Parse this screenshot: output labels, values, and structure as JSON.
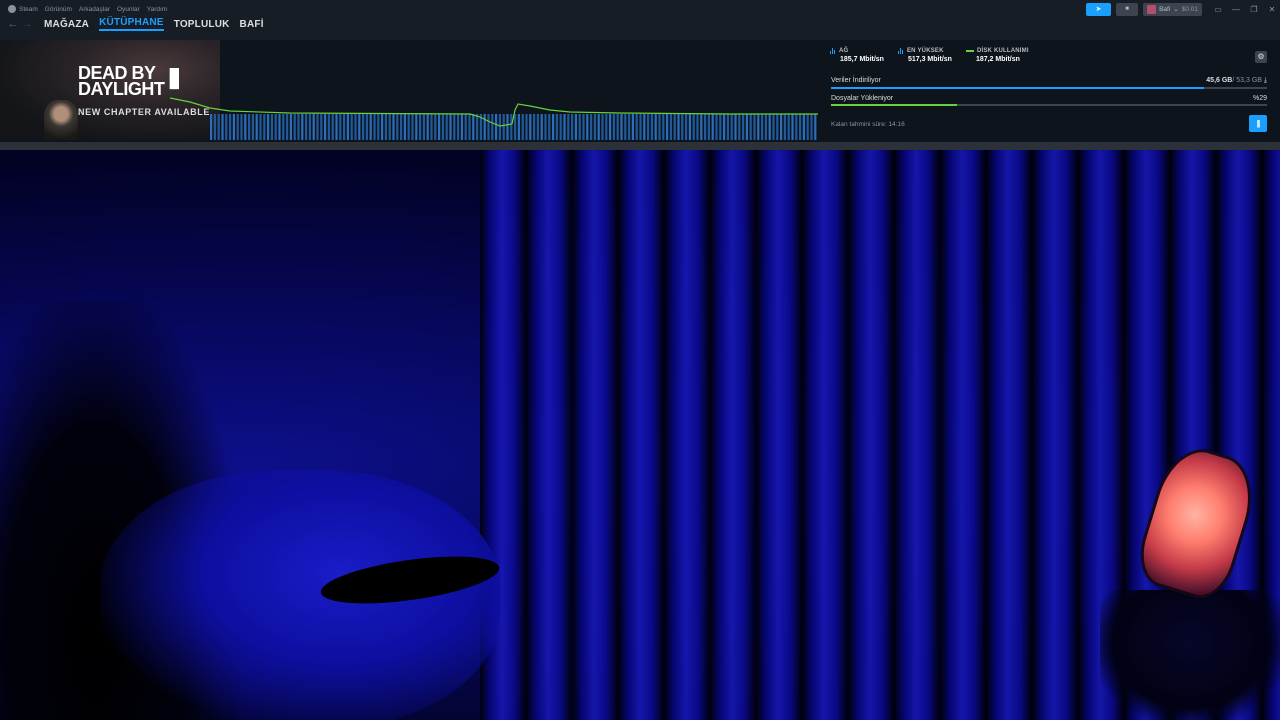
{
  "menu": {
    "app_name": "Steam",
    "items": [
      "Görünüm",
      "Arkadaşlar",
      "Oyunlar",
      "Yardım"
    ]
  },
  "nav": {
    "tabs": [
      "MAĞAZA",
      "KÜTÜPHANE",
      "TOPLULUK",
      "BAFİ"
    ],
    "active_tab": "KÜTÜPHANE"
  },
  "account": {
    "username": "Bafi",
    "balance": "$0.01"
  },
  "banner": {
    "game_title_line1": "DEAD BY",
    "game_title_line2": "DAYLIGHT",
    "subtitle": "NEW CHAPTER AVAILABLE"
  },
  "stats": {
    "network_label": "AĞ",
    "network_value": "185,7 Mbit/sn",
    "peak_label": "EN YÜKSEK",
    "peak_value": "517,3 Mbit/sn",
    "disk_label": "DİSK KULLANIMI",
    "disk_value": "187,2 Mbit/sn"
  },
  "download": {
    "status_label": "Veriler İndiriliyor",
    "downloaded": "45,6 GB",
    "total": "/ 53,3 GB",
    "download_progress": 0.855,
    "files_label": "Dosyalar Yükleniyor",
    "files_percent": "%29",
    "files_progress": 0.29,
    "eta": "Kalan tahmini süre: 14:16"
  },
  "colors": {
    "accent": "#1a9fff",
    "disk_line": "#67d23a",
    "titlebar_bg": "#171d25"
  },
  "icons": [
    "steam-logo-icon",
    "back-arrow-icon",
    "forward-arrow-icon",
    "megaphone-icon",
    "bell-icon",
    "chevron-down-icon",
    "monitor-icon",
    "minimize-icon",
    "maximize-icon",
    "close-icon",
    "network-bars-icon",
    "disk-line-icon",
    "gear-icon",
    "download-icon",
    "pause-icon"
  ]
}
